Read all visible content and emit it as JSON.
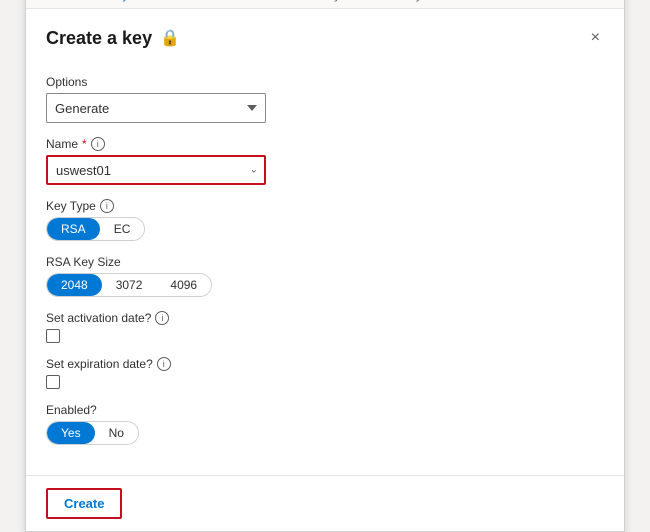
{
  "breadcrumb": {
    "items": [
      {
        "label": "Home",
        "sep": false
      },
      {
        "label": "Select your Azure Data Box",
        "sep": true
      },
      {
        "label": "Order",
        "sep": true
      },
      {
        "label": "Select key from Azure Key Vault",
        "sep": true
      }
    ]
  },
  "modal": {
    "title": "Create a key",
    "close_label": "×",
    "lock_icon": "🔒"
  },
  "form": {
    "options_label": "Options",
    "options_value": "Generate",
    "options_placeholder": "Generate",
    "name_label": "Name",
    "name_required": "*",
    "name_value": "uswest01",
    "key_type_label": "Key Type",
    "key_type_options": [
      {
        "label": "RSA",
        "active": true
      },
      {
        "label": "EC",
        "active": false
      }
    ],
    "rsa_key_size_label": "RSA Key Size",
    "rsa_key_size_options": [
      {
        "label": "2048",
        "active": true
      },
      {
        "label": "3072",
        "active": false
      },
      {
        "label": "4096",
        "active": false
      }
    ],
    "activation_label": "Set activation date?",
    "activation_checked": false,
    "expiration_label": "Set expiration date?",
    "expiration_checked": false,
    "enabled_label": "Enabled?",
    "enabled_options": [
      {
        "label": "Yes",
        "active": true
      },
      {
        "label": "No",
        "active": false
      }
    ]
  },
  "footer": {
    "create_label": "Create"
  },
  "icons": {
    "info": "i",
    "chevron_down": "⌄",
    "lock": "🔒"
  }
}
